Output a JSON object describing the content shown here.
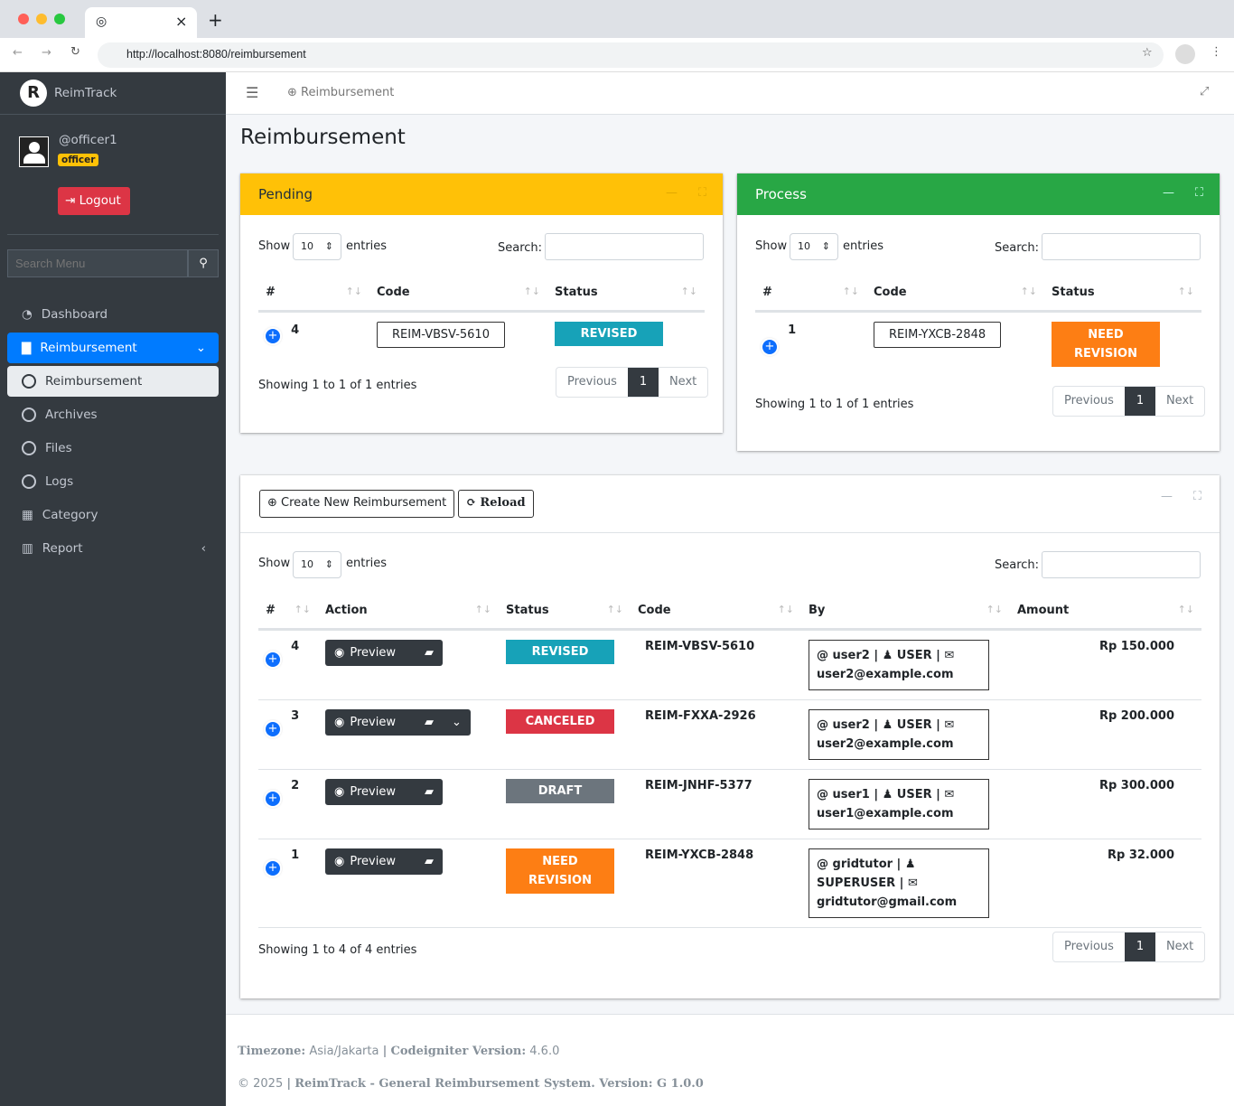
{
  "browser": {
    "url": "http://localhost:8080/reimbursement",
    "tab_close": "×",
    "new_tab": "+"
  },
  "sidebar": {
    "brand": "ReimTrack",
    "username": "@officer1",
    "role": "officer",
    "logout": "Logout",
    "search_placeholder": "Search Menu",
    "items": [
      {
        "label": "Dashboard"
      },
      {
        "label": "Reimbursement"
      },
      {
        "label": "Reimbursement"
      },
      {
        "label": "Archives"
      },
      {
        "label": "Files"
      },
      {
        "label": "Logs"
      },
      {
        "label": "Category"
      },
      {
        "label": "Report"
      }
    ]
  },
  "topbar": {
    "breadcrumb": "Reimbursement"
  },
  "page_title": "Reimbursement",
  "common": {
    "show": "Show",
    "entries": "entries",
    "search": "Search:",
    "page_size": "10",
    "previous": "Previous",
    "next": "Next",
    "page": "1"
  },
  "pending": {
    "title": "Pending",
    "headers": [
      "#",
      "Code",
      "Status"
    ],
    "rows": [
      {
        "id": "4",
        "code": "REIM-VBSV-5610",
        "status": "REVISED"
      }
    ],
    "info": "Showing 1 to 1 of 1 entries"
  },
  "process": {
    "title": "Process",
    "headers": [
      "#",
      "Code",
      "Status"
    ],
    "rows": [
      {
        "id": "1",
        "code": "REIM-YXCB-2848",
        "status": "NEED REVISION"
      }
    ],
    "info": "Showing 1 to 1 of 1 entries"
  },
  "main": {
    "create_label": "Create New Reimbursement",
    "reload_label": "Reload",
    "headers": [
      "#",
      "Action",
      "Status",
      "Code",
      "By",
      "Amount"
    ],
    "preview_label": "Preview",
    "rows": [
      {
        "id": "4",
        "status": "REVISED",
        "code": "REIM-VBSV-5610",
        "by": "@ user2 | ♟ USER | ✉ user2@example.com",
        "amount": "Rp 150.000"
      },
      {
        "id": "3",
        "status": "CANCELED",
        "code": "REIM-FXXA-2926",
        "by": "@ user2 | ♟ USER | ✉ user2@example.com",
        "amount": "Rp 200.000"
      },
      {
        "id": "2",
        "status": "DRAFT",
        "code": "REIM-JNHF-5377",
        "by": "@ user1 | ♟ USER | ✉ user1@example.com",
        "amount": "Rp 300.000"
      },
      {
        "id": "1",
        "status": "NEED REVISION",
        "code": "REIM-YXCB-2848",
        "by": "@ gridtutor | ♟ SUPERUSER | ✉ gridtutor@gmail.com",
        "amount": "Rp 32.000"
      }
    ],
    "info": "Showing 1 to 4 of 4 entries"
  },
  "footer": {
    "tz_label": "Timezone:",
    "tz": "Asia/Jakarta",
    "sep": "|",
    "ci_label": "Codeigniter Version:",
    "ci": "4.6.0",
    "copy": "© 2025",
    "app": "ReimTrack - General Reimbursement System. Version: G 1.0.0"
  },
  "colors": {
    "revised": "#17a2b8",
    "canceled": "#dc3545",
    "draft": "#6c757d",
    "need_revision": "#fd7e14",
    "pending": "#ffc107",
    "process": "#28a745"
  }
}
